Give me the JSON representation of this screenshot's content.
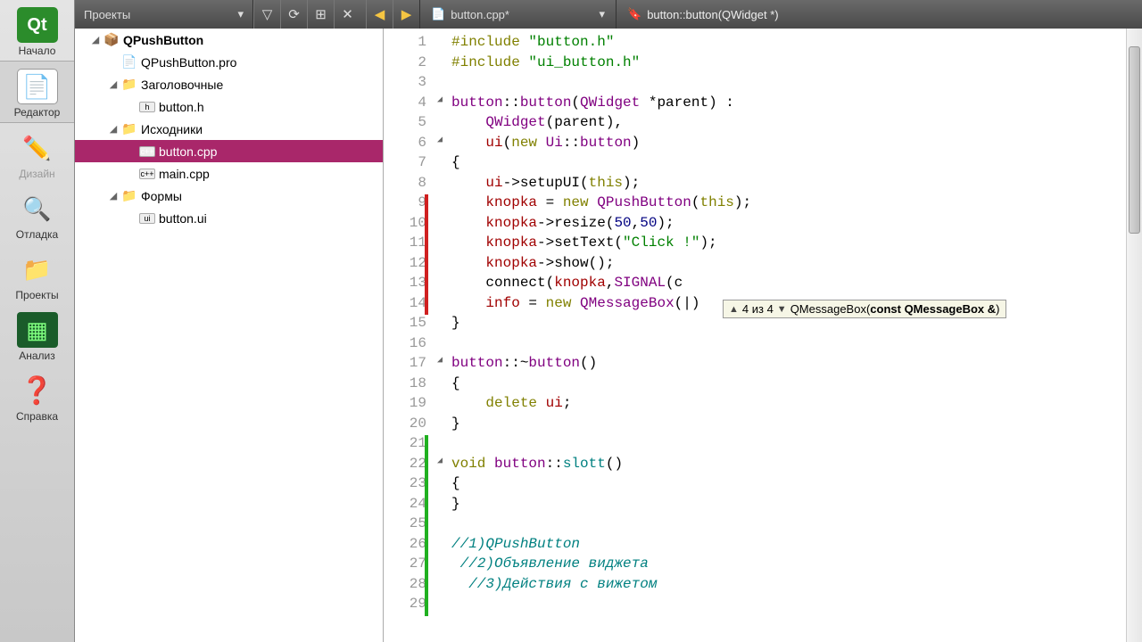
{
  "mode_bar": {
    "items": [
      {
        "label": "Начало",
        "icon": "Qt",
        "color": "#41cd52"
      },
      {
        "label": "Редактор",
        "icon": "📄",
        "active": true
      },
      {
        "label": "Дизайн",
        "icon": "✏️",
        "disabled": true
      },
      {
        "label": "Отладка",
        "icon": "🔍"
      },
      {
        "label": "Проекты",
        "icon": "📁"
      },
      {
        "label": "Анализ",
        "icon": "▦"
      },
      {
        "label": "Справка",
        "icon": "❓"
      }
    ]
  },
  "toolbar": {
    "dropdown_label": "Проекты",
    "filter_icon": "▽",
    "link_icon": "⟳",
    "split_icon": "⊞",
    "close_icon": "✕",
    "back_icon": "◀",
    "fwd_icon": "▶",
    "file_tab": {
      "icon": "📄",
      "label": "button.cpp*",
      "chevron": "▾"
    },
    "symbol_tab": {
      "icon": "🔖",
      "label": "button::button(QWidget *)"
    }
  },
  "tree": [
    {
      "depth": 1,
      "twisty": "◢",
      "icon": "📦",
      "label": "QPushButton",
      "bold": true
    },
    {
      "depth": 2,
      "twisty": "",
      "icon": "📄",
      "label": "QPushButton.pro"
    },
    {
      "depth": 2,
      "twisty": "◢",
      "icon": "📁",
      "label": "Заголовочные"
    },
    {
      "depth": 3,
      "twisty": "",
      "icon": "h",
      "label": "button.h"
    },
    {
      "depth": 2,
      "twisty": "◢",
      "icon": "📁",
      "label": "Исходники"
    },
    {
      "depth": 3,
      "twisty": "",
      "icon": "c++",
      "label": "button.cpp",
      "selected": true
    },
    {
      "depth": 3,
      "twisty": "",
      "icon": "c++",
      "label": "main.cpp"
    },
    {
      "depth": 2,
      "twisty": "◢",
      "icon": "📁",
      "label": "Формы"
    },
    {
      "depth": 3,
      "twisty": "",
      "icon": "ui",
      "label": "button.ui"
    }
  ],
  "code": {
    "lines": [
      {
        "n": 1,
        "html": "<span class='k-olive'>#include</span> <span class='k-green'>\"button.h\"</span>"
      },
      {
        "n": 2,
        "html": "<span class='k-olive'>#include</span> <span class='k-green'>\"ui_button.h\"</span>"
      },
      {
        "n": 3,
        "html": ""
      },
      {
        "n": 4,
        "fold": "◢",
        "html": "<span class='k-purple'>button</span>::<span class='k-purple'>button</span>(<span class='k-purple'>QWidget</span> *parent) :"
      },
      {
        "n": 5,
        "html": "    <span class='k-purple'>QWidget</span>(parent),"
      },
      {
        "n": 6,
        "fold": "◢",
        "html": "    <span class='k-red'>ui</span>(<span class='k-keyword'>new</span> <span class='k-purple'>Ui</span>::<span class='k-purple'>button</span>)"
      },
      {
        "n": 7,
        "html": "{"
      },
      {
        "n": 8,
        "html": "    <span class='k-red'>ui</span>-&gt;setupUI(<span class='k-keyword'>this</span>);"
      },
      {
        "n": 9,
        "html": "    <span class='k-red'>knopka</span> = <span class='k-keyword'>new</span> <span class='k-purple'>QPushButton</span>(<span class='k-keyword'>this</span>);"
      },
      {
        "n": 10,
        "html": "    <span class='k-red'>knopka</span>-&gt;resize(<span class='k-blue'>50</span>,<span class='k-blue'>50</span>);"
      },
      {
        "n": 11,
        "html": "    <span class='k-red'>knopka</span>-&gt;setText(<span class='k-green'>\"Click !\"</span>);"
      },
      {
        "n": 12,
        "html": "    <span class='k-red'>knopka</span>-&gt;show();"
      },
      {
        "n": 13,
        "html": "    connect(<span class='k-red'>knopka</span>,<span class='k-purple'>SIGNAL</span>(c"
      },
      {
        "n": 14,
        "html": "    <span class='k-red'>info</span> = <span class='k-keyword'>new</span> <span class='k-purple'>QMessageBox</span>(|)"
      },
      {
        "n": 15,
        "html": "}"
      },
      {
        "n": 16,
        "html": ""
      },
      {
        "n": 17,
        "fold": "◢",
        "html": "<span class='k-purple'>button</span>::~<span class='k-purple'>button</span>()"
      },
      {
        "n": 18,
        "html": "{"
      },
      {
        "n": 19,
        "html": "    <span class='k-keyword'>delete</span> <span class='k-red'>ui</span>;"
      },
      {
        "n": 20,
        "html": "}"
      },
      {
        "n": 21,
        "html": ""
      },
      {
        "n": 22,
        "fold": "◢",
        "html": "<span class='k-keyword'>void</span> <span class='k-purple'>button</span>::<span class='k-teal'>slott</span>()"
      },
      {
        "n": 23,
        "html": "{"
      },
      {
        "n": 24,
        "html": "}"
      },
      {
        "n": 25,
        "html": ""
      },
      {
        "n": 26,
        "html": "<span class='k-comment'>//1)QPushButton</span>"
      },
      {
        "n": 27,
        "html": " <span class='k-comment'>//2)Объявление виджета</span>"
      },
      {
        "n": 28,
        "html": "  <span class='k-comment'>//3)Действия с вижетом</span>"
      },
      {
        "n": 29,
        "html": ""
      }
    ],
    "markers": [
      {
        "from": 9,
        "to": 14,
        "class": "red"
      },
      {
        "from": 21,
        "to": 29,
        "class": "green"
      }
    ]
  },
  "tooltip": {
    "counter": "4 из 4",
    "text_prefix": "QMessageBox(",
    "text_bold": "const QMessageBox &",
    "text_suffix": ")"
  }
}
